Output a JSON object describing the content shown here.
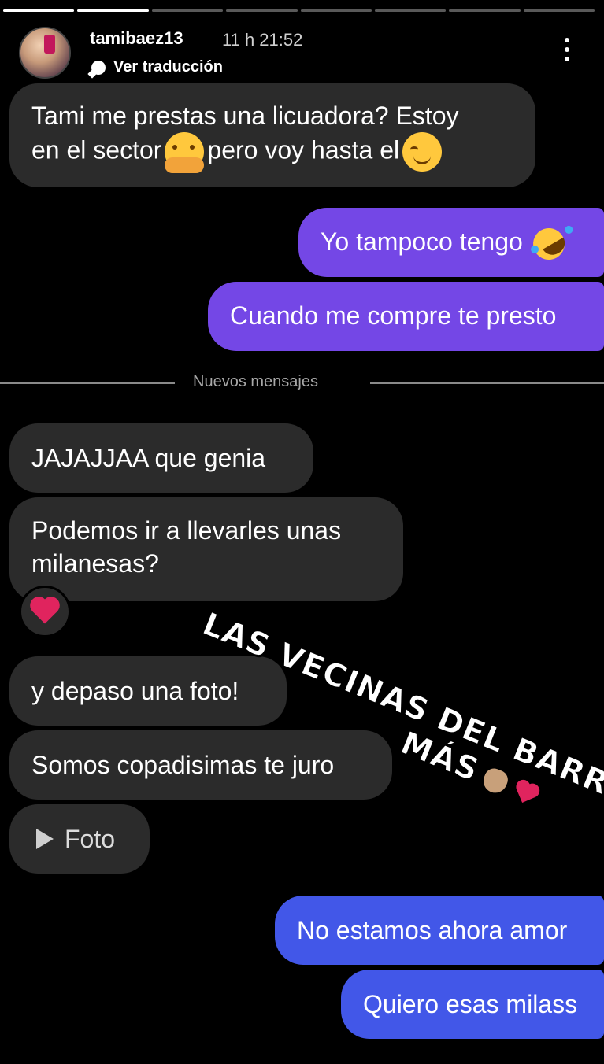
{
  "progress": {
    "segments": 8,
    "completed": 2
  },
  "header": {
    "username": "tamibaez13",
    "time": "11 h 21:52",
    "translate_label": "Ver traducción"
  },
  "messages": {
    "m1_line1": "Tami me prestas una licuadora? Estoy",
    "m1_line2a": "en el sector",
    "m1_line2b": "pero voy hasta el",
    "m2": "Yo tampoco tengo",
    "m3": "Cuando me compre te presto",
    "divider": "Nuevos mensajes",
    "m4": "JAJAJJAA que genia",
    "m5_line1": "Podemos ir a llevarles unas",
    "m5_line2": "milanesas?",
    "m6": "y depaso una foto!",
    "m7": "Somos copadisimas te juro",
    "m8": "Foto",
    "m9": "No estamos ahora amor",
    "m10": "Quiero esas milass"
  },
  "sticker": {
    "line1": "LAS VECINAS DEL BARRIO SON LO",
    "line2": "MÁS"
  },
  "icons": {
    "menu": "more-vertical-icon",
    "translate": "speech-bubble-icon",
    "reaction": "red-heart-icon"
  },
  "colors": {
    "incoming_bubble": "#2b2b2b",
    "outgoing_purple": "#7447e6",
    "outgoing_blue": "#4257e8"
  }
}
